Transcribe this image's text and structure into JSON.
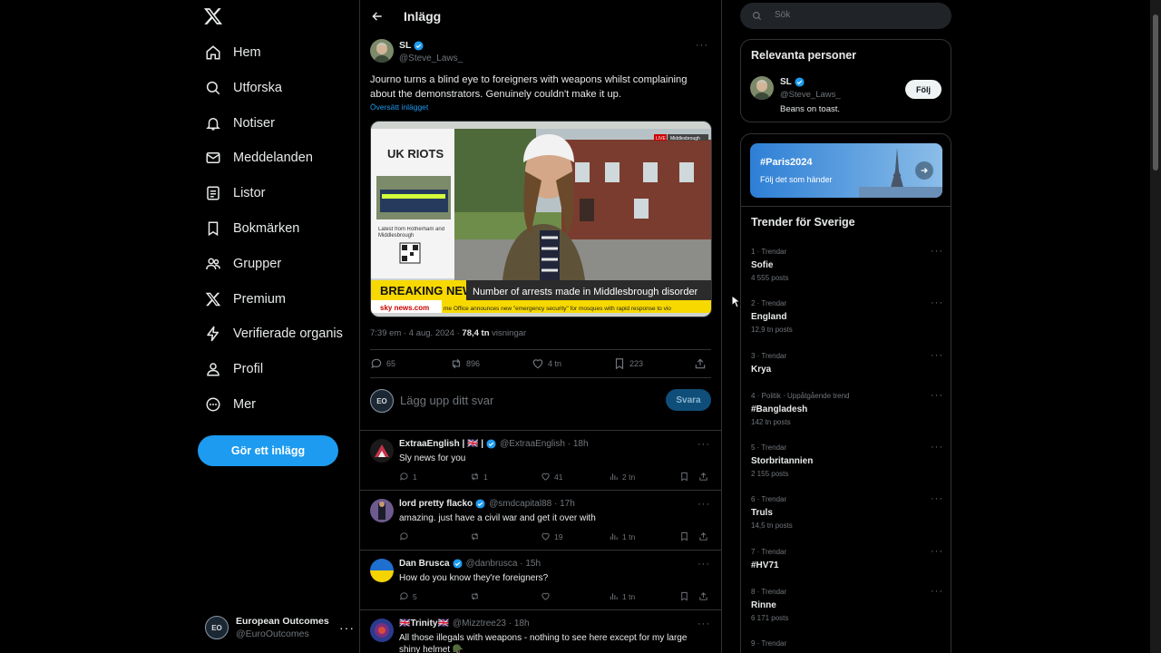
{
  "nav": {
    "items": [
      {
        "label": "Hem",
        "icon": "home-icon"
      },
      {
        "label": "Utforska",
        "icon": "search-icon"
      },
      {
        "label": "Notiser",
        "icon": "bell-icon"
      },
      {
        "label": "Meddelanden",
        "icon": "mail-icon"
      },
      {
        "label": "Listor",
        "icon": "list-icon"
      },
      {
        "label": "Bokmärken",
        "icon": "bookmark-icon"
      },
      {
        "label": "Grupper",
        "icon": "people-icon"
      },
      {
        "label": "Premium",
        "icon": "x-logo-icon"
      },
      {
        "label": "Verifierade organis",
        "icon": "lightning-icon"
      },
      {
        "label": "Profil",
        "icon": "person-icon"
      },
      {
        "label": "Mer",
        "icon": "more-circle-icon"
      }
    ],
    "post_button": "Gör ett inlägg",
    "account": {
      "avatar_text": "EO",
      "name": "European Outcomes",
      "handle": "@EuroOutcomes",
      "more": "···"
    }
  },
  "main": {
    "title": "Inlägg",
    "post": {
      "name": "SL",
      "handle": "@Steve_Laws_",
      "more": "···",
      "text": "Journo turns a blind eye to foreigners with weapons whilst complaining about the demonstrators. Genuinely couldn't make it up.",
      "translate": "Översätt inlägget",
      "media": {
        "topic": "UK RIOTS",
        "latest": "Latest from Rotherham and Middlesbrough",
        "live": "LIVE",
        "location": "Middlesbrough",
        "breaking": "BREAKING NEWS",
        "headline": "Number of arrests made in Middlesbrough disorder",
        "brand": "sky news.com",
        "ticker": "me Office announces new \"emergency security\" for mosques with rapid response to vio"
      },
      "time": "7:39 em · 4 aug. 2024 · ",
      "views_value": "78,4 tn",
      "views_label": " visningar",
      "replies": "65",
      "reposts": "896",
      "likes": "4 tn",
      "bookmarks": "223"
    },
    "reply_box": {
      "avatar_text": "EO",
      "placeholder": "Lägg upp ditt svar",
      "button": "Svara"
    },
    "replies": [
      {
        "name": "ExtraaEnglish | 🇬🇧 |",
        "handle": "@ExtraaEnglish · 18h",
        "text": "Sly news for you",
        "replies": "1",
        "reposts": "1",
        "likes": "41",
        "views": "2 tn"
      },
      {
        "name": "lord pretty flacko",
        "handle": "@smdcapital88 · 17h",
        "text": "amazing. just have a civil war and get it over with",
        "replies": "",
        "reposts": "",
        "likes": "19",
        "views": "1 tn"
      },
      {
        "name": "Dan Brusca",
        "handle": "@danbrusca · 15h",
        "text": "How do you know they're foreigners?",
        "replies": "5",
        "reposts": "",
        "likes": "",
        "views": "1 tn"
      },
      {
        "name": "🇬🇧Trinity🇬🇧",
        "handle": "@Mizztree23 · 18h",
        "text": "All those illegals with weapons - nothing to see here except for my large shiny helmet 🪖",
        "replies": "",
        "reposts": "",
        "likes": "",
        "views": ""
      }
    ]
  },
  "right": {
    "search_placeholder": "Sök",
    "people": {
      "title": "Relevanta personer",
      "name": "SL",
      "handle": "@Steve_Laws_",
      "bio": "Beans on toast.",
      "follow": "Följ"
    },
    "banner": {
      "title": "#Paris2024",
      "subtitle": "Följ det som händer"
    },
    "trends_title": "Trender för Sverige",
    "trends": [
      {
        "meta": "1 · Trendar",
        "name": "Sofie",
        "count": "4 555 posts"
      },
      {
        "meta": "2 · Trendar",
        "name": "England",
        "count": "12,9 tn posts"
      },
      {
        "meta": "3 · Trendar",
        "name": "Krya",
        "count": ""
      },
      {
        "meta": "4 · Politik · Uppåtgående trend",
        "name": "#Bangladesh",
        "count": "142 tn posts"
      },
      {
        "meta": "5 · Trendar",
        "name": "Storbritannien",
        "count": "2 155 posts"
      },
      {
        "meta": "6 · Trendar",
        "name": "Truls",
        "count": "14,5 tn posts"
      },
      {
        "meta": "7 · Trendar",
        "name": "#HV71",
        "count": ""
      },
      {
        "meta": "8 · Trendar",
        "name": "Rinne",
        "count": "6 171 posts"
      },
      {
        "meta": "9 · Trendar",
        "name": "",
        "count": ""
      }
    ],
    "trend_more": "···"
  },
  "colors": {
    "accent": "#1d9bf0",
    "background": "#000000",
    "border": "#2f3336",
    "muted": "#71767b",
    "text": "#e7e9ea"
  }
}
